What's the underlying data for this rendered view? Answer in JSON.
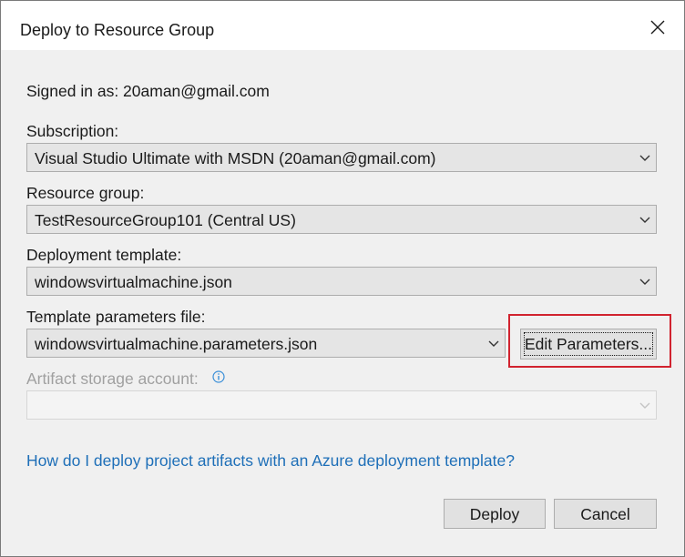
{
  "window": {
    "title": "Deploy to Resource Group"
  },
  "account": {
    "signed_in_text": "Signed in as: 20aman@gmail.com"
  },
  "subscription": {
    "label": "Subscription:",
    "value": "Visual Studio Ultimate with MSDN (20aman@gmail.com)"
  },
  "resource_group": {
    "label": "Resource group:",
    "value": "TestResourceGroup101 (Central US)"
  },
  "deployment_template": {
    "label": "Deployment template:",
    "value": "windowsvirtualmachine.json"
  },
  "parameters_file": {
    "label": "Template parameters file:",
    "value": "windowsvirtualmachine.parameters.json",
    "edit_button": "Edit Parameters..."
  },
  "artifact_storage": {
    "label": "Artifact storage account:",
    "value": ""
  },
  "help_link": "How do I deploy project artifacts with an Azure deployment template?",
  "buttons": {
    "deploy": "Deploy",
    "cancel": "Cancel"
  },
  "colors": {
    "highlight": "#d1232f",
    "link": "#1e6fb8",
    "info_icon": "#3a8fd8"
  }
}
